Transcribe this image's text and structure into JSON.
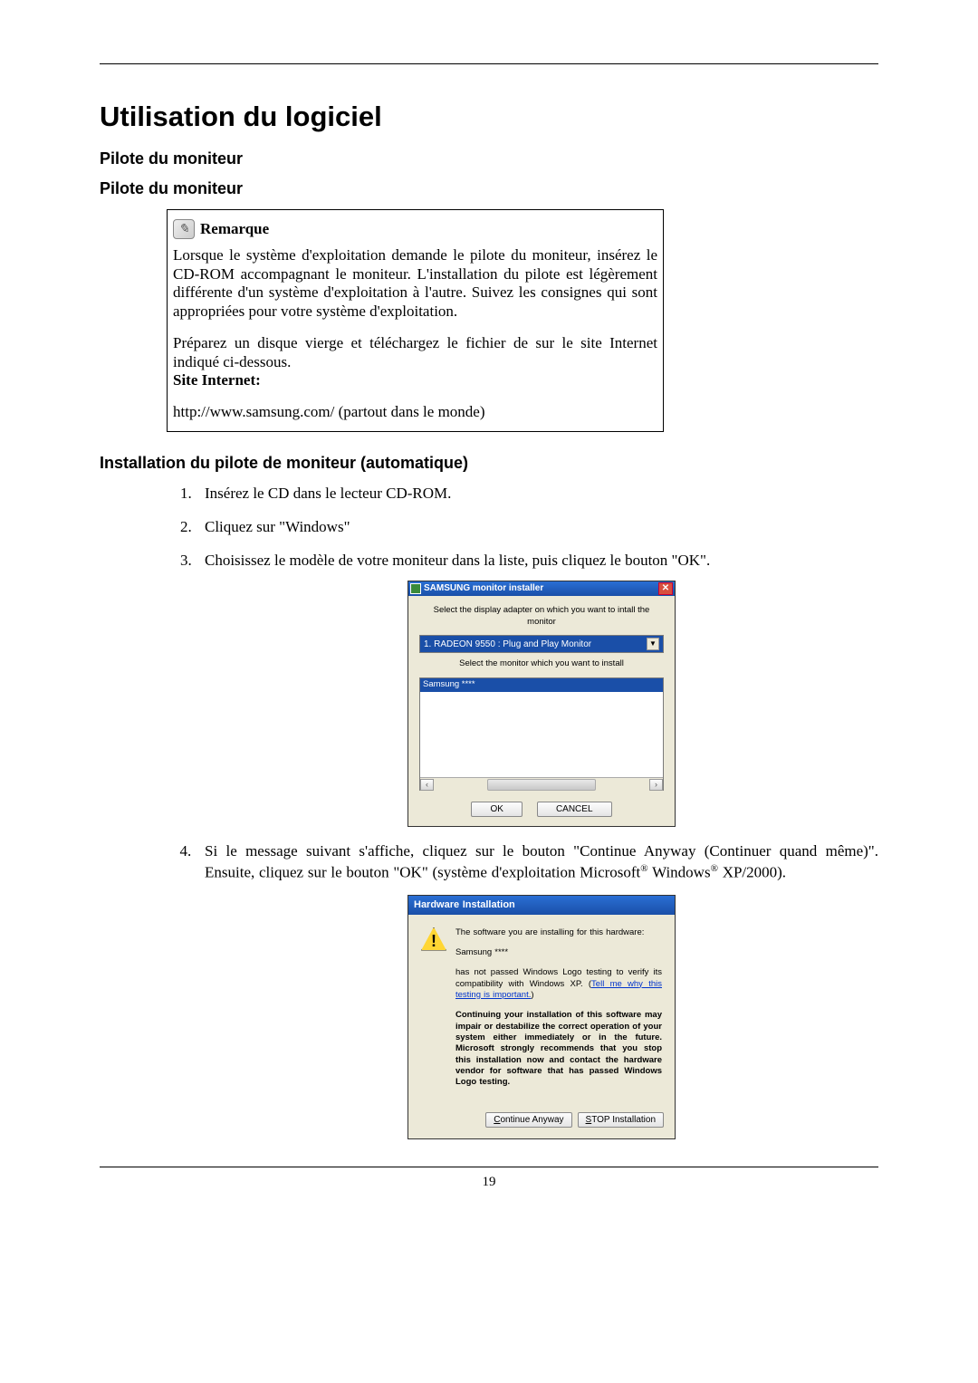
{
  "heading": "Utilisation du logiciel",
  "subheading1": "Pilote du moniteur",
  "subheading2": "Pilote du moniteur",
  "remarque": {
    "title": "Remarque",
    "p1": "Lorsque le système d'exploitation demande le pilote du moniteur, insérez le CD-ROM accompagnant le moniteur. L'installation du pilote est légèrement différente d'un système d'exploitation à l'autre. Suivez les consignes qui sont appropriées pour votre système d'exploitation.",
    "p2a": "Préparez un disque vierge et téléchargez le fichier de sur le site Internet indiqué ci-dessous.",
    "siteLabel": "Site Internet:",
    "url": "http://www.samsung.com/ (partout dans le monde)"
  },
  "installHeading": "Installation du pilote de moniteur (automatique)",
  "steps": {
    "s1": "Insérez le CD dans le lecteur CD-ROM.",
    "s2": "Cliquez sur \"Windows\"",
    "s3": "Choisissez le modèle de votre moniteur dans la liste, puis cliquez le bouton \"OK\".",
    "s4a": "Si le message suivant s'affiche, cliquez sur le bouton \"Continue Anyway (Continuer quand même)\". Ensuite, cliquez sur le bouton \"OK\" (système d'exploitation Microsoft",
    "s4b": " Windows",
    "s4c": " XP/2000)."
  },
  "installer": {
    "title": "SAMSUNG monitor installer",
    "label1": "Select the display adapter on which you want to intall the monitor",
    "adapter": "1. RADEON 9550 : Plug and Play Monitor",
    "label2": "Select the monitor which you want to install",
    "monitor": "Samsung ****",
    "ok": "OK",
    "cancel": "CANCEL"
  },
  "hw": {
    "title": "Hardware Installation",
    "line1": "The software you are installing for this hardware:",
    "line2": "Samsung ****",
    "line3a": "has not passed Windows Logo testing to verify its compatibility with Windows XP. (",
    "link": "Tell me why this testing is important.",
    "line3b": ")",
    "bold": "Continuing your installation of this software may impair or destabilize the correct operation of your system either immediately or in the future. Microsoft strongly recommends that you stop this installation now and contact the hardware vendor for software that has passed Windows Logo testing.",
    "btnContinueC": "C",
    "btnContinueRest": "ontinue Anyway",
    "btnStopS": "S",
    "btnStopRest": "TOP Installation"
  },
  "pageNumber": "19"
}
